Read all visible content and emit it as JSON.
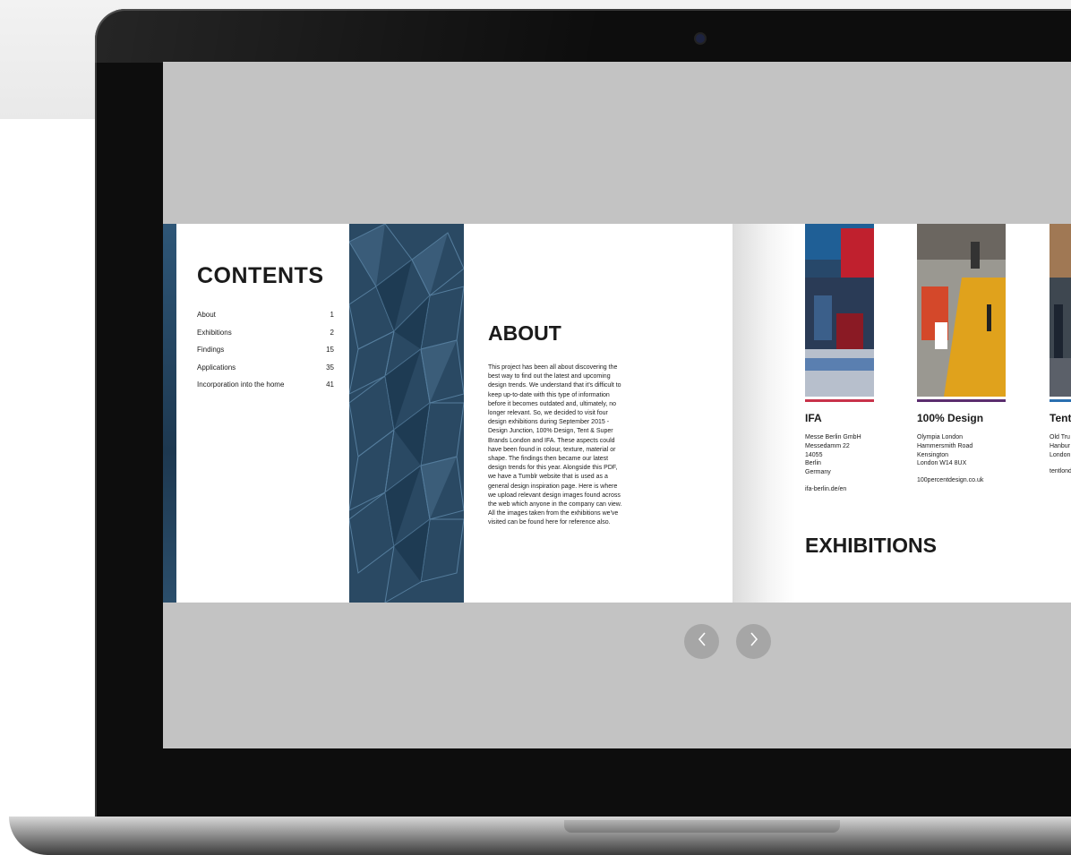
{
  "flipbook": {
    "contents": {
      "title": "CONTENTS",
      "items": [
        {
          "label": "About",
          "page": "1"
        },
        {
          "label": "Exhibitions",
          "page": "2"
        },
        {
          "label": "Findings",
          "page": "15"
        },
        {
          "label": "Applications",
          "page": "35"
        },
        {
          "label": "Incorporation into the home",
          "page": "41"
        }
      ]
    },
    "about": {
      "title": "ABOUT",
      "body": "This project has been all about discovering the best way to find out the latest and upcoming design trends. We understand that it's difficult to keep up-to-date with this type of information before it becomes outdated and, ultimately, no longer relevant. So, we decided to visit four design exhibitions during September 2015 - Design Junction, 100% Design, Tent & Super Brands London and IFA. These aspects could have been found in colour, texture, material or shape. The findings then became our latest design trends for this year. Alongside this PDF, we have a Tumblr website that is used as a general design inspiration page. Here is where we upload relevant design images found across the web which anyone in the company can view. All the images taken from the exhibitions we've visited can be found here for reference also."
    },
    "exhibitions": {
      "title": "EXHIBITIONS",
      "items": [
        {
          "name": "IFA",
          "address": "Messe Berlin GmbH\nMessedamm 22\n14055\nBerlin\nGermany",
          "link": "ifa-berlin.de/en",
          "color": "#c8324a"
        },
        {
          "name": "100% Design",
          "address": "Olympia London\nHammersmith Road\nKensington\nLondon W14 8UX",
          "link": "100percentdesign.co.uk",
          "color": "#5b2d6e"
        },
        {
          "name": "Tent",
          "address": "Old Tru\nHanbur\nLondon",
          "link": "tentlond",
          "color": "#2a6fb0"
        }
      ]
    }
  },
  "navigation": {
    "prev_icon": "chevron-left-icon",
    "next_icon": "chevron-right-icon"
  }
}
